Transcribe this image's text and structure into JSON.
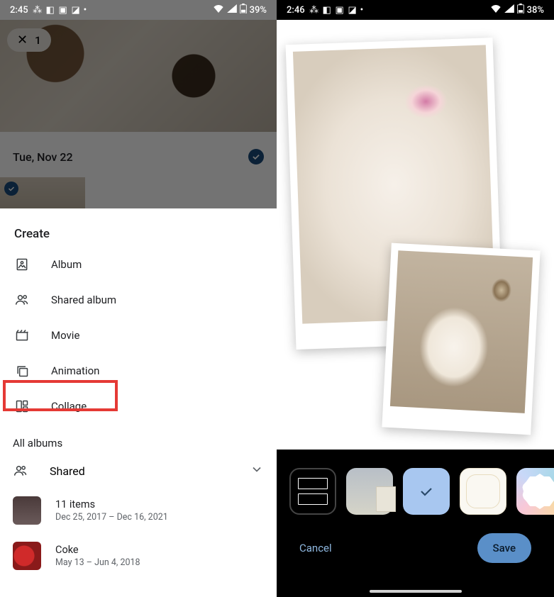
{
  "left": {
    "status": {
      "time": "2:45",
      "battery": "39%"
    },
    "selection_count": "1",
    "date_label": "Tue, Nov 22",
    "sheet_title": "Create",
    "menu": [
      {
        "label": "Album"
      },
      {
        "label": "Shared album"
      },
      {
        "label": "Movie"
      },
      {
        "label": "Animation"
      },
      {
        "label": "Collage"
      }
    ],
    "all_albums_label": "All albums",
    "shared_label": "Shared",
    "albums": [
      {
        "title": "11 items",
        "subtitle": "Dec 25, 2017 – Dec 16, 2021"
      },
      {
        "title": "Coke",
        "subtitle": "May 13 – Jun 4, 2018"
      }
    ]
  },
  "right": {
    "status": {
      "time": "2:46",
      "battery": "38%"
    },
    "cancel_label": "Cancel",
    "save_label": "Save",
    "selected_template_index": 2
  }
}
